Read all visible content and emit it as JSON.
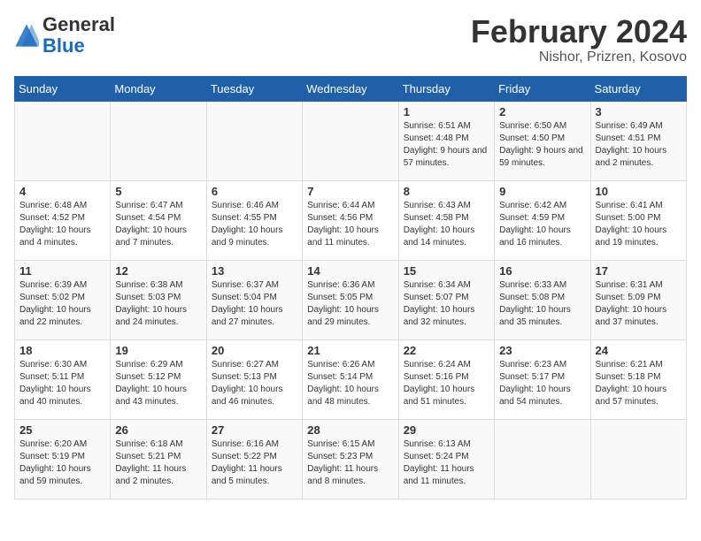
{
  "header": {
    "logo": {
      "general": "General",
      "blue": "Blue"
    },
    "title": "February 2024",
    "subtitle": "Nishor, Prizren, Kosovo"
  },
  "days_of_week": [
    "Sunday",
    "Monday",
    "Tuesday",
    "Wednesday",
    "Thursday",
    "Friday",
    "Saturday"
  ],
  "weeks": [
    [
      {
        "day": "",
        "info": ""
      },
      {
        "day": "",
        "info": ""
      },
      {
        "day": "",
        "info": ""
      },
      {
        "day": "",
        "info": ""
      },
      {
        "day": "1",
        "info": "Sunrise: 6:51 AM\nSunset: 4:48 PM\nDaylight: 9 hours and 57 minutes."
      },
      {
        "day": "2",
        "info": "Sunrise: 6:50 AM\nSunset: 4:50 PM\nDaylight: 9 hours and 59 minutes."
      },
      {
        "day": "3",
        "info": "Sunrise: 6:49 AM\nSunset: 4:51 PM\nDaylight: 10 hours and 2 minutes."
      }
    ],
    [
      {
        "day": "4",
        "info": "Sunrise: 6:48 AM\nSunset: 4:52 PM\nDaylight: 10 hours and 4 minutes."
      },
      {
        "day": "5",
        "info": "Sunrise: 6:47 AM\nSunset: 4:54 PM\nDaylight: 10 hours and 7 minutes."
      },
      {
        "day": "6",
        "info": "Sunrise: 6:46 AM\nSunset: 4:55 PM\nDaylight: 10 hours and 9 minutes."
      },
      {
        "day": "7",
        "info": "Sunrise: 6:44 AM\nSunset: 4:56 PM\nDaylight: 10 hours and 11 minutes."
      },
      {
        "day": "8",
        "info": "Sunrise: 6:43 AM\nSunset: 4:58 PM\nDaylight: 10 hours and 14 minutes."
      },
      {
        "day": "9",
        "info": "Sunrise: 6:42 AM\nSunset: 4:59 PM\nDaylight: 10 hours and 16 minutes."
      },
      {
        "day": "10",
        "info": "Sunrise: 6:41 AM\nSunset: 5:00 PM\nDaylight: 10 hours and 19 minutes."
      }
    ],
    [
      {
        "day": "11",
        "info": "Sunrise: 6:39 AM\nSunset: 5:02 PM\nDaylight: 10 hours and 22 minutes."
      },
      {
        "day": "12",
        "info": "Sunrise: 6:38 AM\nSunset: 5:03 PM\nDaylight: 10 hours and 24 minutes."
      },
      {
        "day": "13",
        "info": "Sunrise: 6:37 AM\nSunset: 5:04 PM\nDaylight: 10 hours and 27 minutes."
      },
      {
        "day": "14",
        "info": "Sunrise: 6:36 AM\nSunset: 5:05 PM\nDaylight: 10 hours and 29 minutes."
      },
      {
        "day": "15",
        "info": "Sunrise: 6:34 AM\nSunset: 5:07 PM\nDaylight: 10 hours and 32 minutes."
      },
      {
        "day": "16",
        "info": "Sunrise: 6:33 AM\nSunset: 5:08 PM\nDaylight: 10 hours and 35 minutes."
      },
      {
        "day": "17",
        "info": "Sunrise: 6:31 AM\nSunset: 5:09 PM\nDaylight: 10 hours and 37 minutes."
      }
    ],
    [
      {
        "day": "18",
        "info": "Sunrise: 6:30 AM\nSunset: 5:11 PM\nDaylight: 10 hours and 40 minutes."
      },
      {
        "day": "19",
        "info": "Sunrise: 6:29 AM\nSunset: 5:12 PM\nDaylight: 10 hours and 43 minutes."
      },
      {
        "day": "20",
        "info": "Sunrise: 6:27 AM\nSunset: 5:13 PM\nDaylight: 10 hours and 46 minutes."
      },
      {
        "day": "21",
        "info": "Sunrise: 6:26 AM\nSunset: 5:14 PM\nDaylight: 10 hours and 48 minutes."
      },
      {
        "day": "22",
        "info": "Sunrise: 6:24 AM\nSunset: 5:16 PM\nDaylight: 10 hours and 51 minutes."
      },
      {
        "day": "23",
        "info": "Sunrise: 6:23 AM\nSunset: 5:17 PM\nDaylight: 10 hours and 54 minutes."
      },
      {
        "day": "24",
        "info": "Sunrise: 6:21 AM\nSunset: 5:18 PM\nDaylight: 10 hours and 57 minutes."
      }
    ],
    [
      {
        "day": "25",
        "info": "Sunrise: 6:20 AM\nSunset: 5:19 PM\nDaylight: 10 hours and 59 minutes."
      },
      {
        "day": "26",
        "info": "Sunrise: 6:18 AM\nSunset: 5:21 PM\nDaylight: 11 hours and 2 minutes."
      },
      {
        "day": "27",
        "info": "Sunrise: 6:16 AM\nSunset: 5:22 PM\nDaylight: 11 hours and 5 minutes."
      },
      {
        "day": "28",
        "info": "Sunrise: 6:15 AM\nSunset: 5:23 PM\nDaylight: 11 hours and 8 minutes."
      },
      {
        "day": "29",
        "info": "Sunrise: 6:13 AM\nSunset: 5:24 PM\nDaylight: 11 hours and 11 minutes."
      },
      {
        "day": "",
        "info": ""
      },
      {
        "day": "",
        "info": ""
      }
    ]
  ]
}
